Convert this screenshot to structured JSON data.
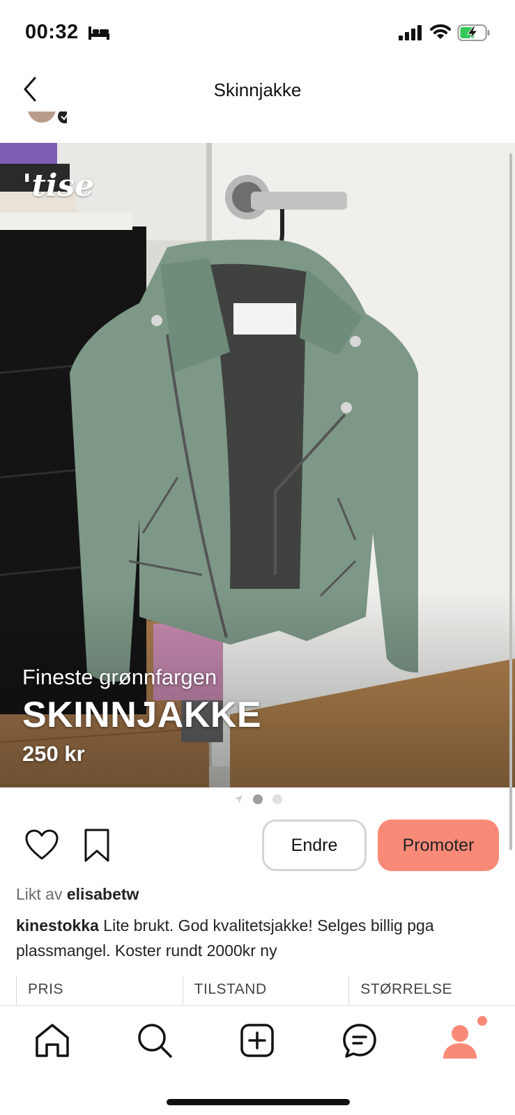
{
  "status_bar": {
    "time": "00:32",
    "icons": [
      "bed-icon",
      "signal-icon",
      "wifi-icon",
      "battery-charging-icon"
    ]
  },
  "nav": {
    "title": "Skinnjakke",
    "back_icon": "chevron-left-icon"
  },
  "listing": {
    "watermark": "'tise",
    "subtitle": "Fineste grønnfargen",
    "title": "SKINNJAKKE",
    "price": "250 kr",
    "image_count": 2,
    "active_image": 1
  },
  "actions": {
    "edit_label": "Endre",
    "promote_label": "Promoter"
  },
  "likes": {
    "prefix": "Likt av",
    "user": "elisabetw"
  },
  "description": {
    "user": "kinestokka",
    "text": "Lite brukt. God kvalitetsjakke! Selges billig pga plassmangel. Koster rundt 2000kr ny"
  },
  "info_headers": [
    "PRIS",
    "TILSTAND",
    "STØRRELSE"
  ],
  "tab_bar": {
    "tabs": [
      "home-icon",
      "search-icon",
      "add-icon",
      "chat-icon",
      "profile-icon"
    ]
  },
  "colors": {
    "accent": "#fa8a78",
    "jacket": "#7e9a88"
  }
}
